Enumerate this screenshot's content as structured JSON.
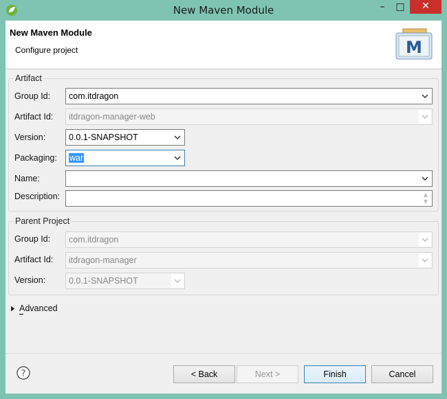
{
  "window": {
    "title": "New Maven Module",
    "minimize": "–",
    "maximize": "□",
    "close": "✕"
  },
  "banner": {
    "title": "New Maven Module",
    "subtitle": "Configure project",
    "logo_letter": "M"
  },
  "artifact": {
    "group_label": "Artifact",
    "group_id_label": "Group Id:",
    "group_id_value": "com.itdragon",
    "artifact_id_label": "Artifact Id:",
    "artifact_id_value": "itdragon-manager-web",
    "version_label": "Version:",
    "version_value": "0.0.1-SNAPSHOT",
    "packaging_label": "Packaging:",
    "packaging_value": "war",
    "name_label": "Name:",
    "name_value": "",
    "description_label": "Description:",
    "description_value": ""
  },
  "parent": {
    "group_label": "Parent Project",
    "group_id_label": "Group Id:",
    "group_id_value": "com.itdragon",
    "artifact_id_label": "Artifact Id:",
    "artifact_id_value": "itdragon-manager",
    "version_label": "Version:",
    "version_value": "0.0.1-SNAPSHOT"
  },
  "advanced": {
    "label": "Advanced",
    "mnemonic": "v"
  },
  "footer": {
    "help_symbol": "?",
    "back_label": "< Back",
    "next_label": "Next >",
    "finish_label": "Finish",
    "cancel_label": "Cancel"
  },
  "colors": {
    "title_bar": "#7fc4b2",
    "selection": "#3399ff",
    "close_button": "#c9302c"
  },
  "icons": [
    "eclipse-spring-icon",
    "maven-logo-icon",
    "help-icon",
    "chevron-down-icon",
    "triangle-right-icon"
  ]
}
